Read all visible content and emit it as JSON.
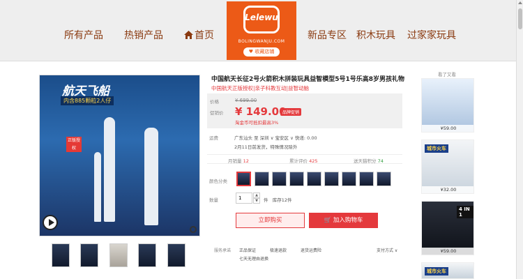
{
  "nav": {
    "all_products": "所有产品",
    "hot_products": "热销产品",
    "home": "首页",
    "new_area": "新品专区",
    "block_toys": "积木玩具",
    "holiday_toys": "过家家玩具"
  },
  "logo": {
    "brand": "Lelewu",
    "url": "BOLINGWANJU.COM",
    "favorite": "收藏店铺"
  },
  "gallery": {
    "image_title": "航天飞船",
    "image_subtitle": "内含885颗粒2人仔",
    "stamp": "正版授权"
  },
  "product": {
    "title": "中国航天长征2号火箭积木拼装玩具益智模型5号1号乐高8岁男孩礼物",
    "subtitle": "中国航天正版授权|亲子科教互动|益智动脑",
    "price_label": "价格",
    "original_price": "¥ 699.00",
    "promo_label": "促销价",
    "current_price": "¥ 149.00",
    "promo_tag": "品牌促销",
    "points_note": "淘金币可抵扣最高3%",
    "shipping_label": "运费",
    "shipping_from": "广东汕头 至 深圳 ∨ 宝安区 ∨ 快递: 0.00",
    "shipping_note": "2月11日前发货，特殊情况除外",
    "monthly_sales_label": "月销量",
    "monthly_sales": "12",
    "reviews_label": "累计评价",
    "reviews": "425",
    "points_label": "送天猫积分",
    "points": "74",
    "color_label": "颜色分类",
    "qty_label": "数量",
    "qty_value": "1",
    "qty_unit": "件",
    "stock": "库存12件",
    "buy_now": "立即购买",
    "add_cart": "加入购物车",
    "service_label": "服务承诺",
    "service_1": "正品保证",
    "service_2": "极速退款",
    "service_3": "退货运费险",
    "service_4": "七天无理由退换",
    "payment": "支付方式 ∨"
  },
  "sidebar": {
    "title": "看了又看",
    "items": [
      {
        "price": "¥59.00",
        "caption": ""
      },
      {
        "price": "¥32.00",
        "caption": "城市火车"
      },
      {
        "price": "¥59.00",
        "caption": "4 IN 1"
      },
      {
        "price": "",
        "caption": "城市火车"
      }
    ]
  },
  "colors": {
    "accent": "#e4393c",
    "brand": "#ec5a17",
    "nav_text": "#8a3a10",
    "green": "#2e9e3b"
  }
}
